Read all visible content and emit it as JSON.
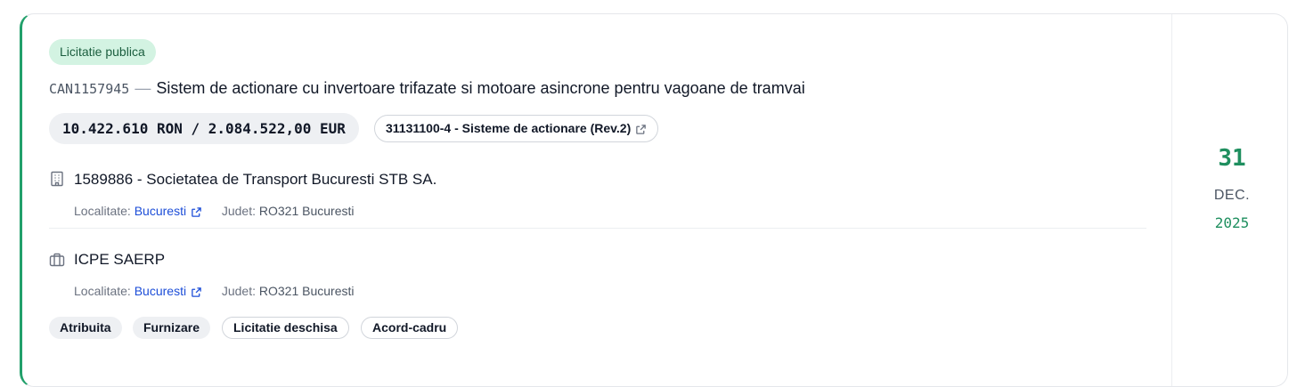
{
  "status_badge": "Licitatie publica",
  "notice": {
    "code": "CAN1157945",
    "separator": "—",
    "title": "Sistem de actionare cu invertoare trifazate si motoare asincrone pentru vagoane de tramvai"
  },
  "price": "10.422.610 RON / 2.084.522,00 EUR",
  "cpv": "31131100-4 - Sisteme de actionare (Rev.2)",
  "authority": {
    "name": "1589886 - Societatea de Transport Bucuresti STB SA.",
    "locality_label": "Localitate:",
    "locality": "Bucuresti",
    "county_label": "Judet:",
    "county": "RO321 Bucuresti"
  },
  "supplier": {
    "name": "ICPE SAERP",
    "locality_label": "Localitate:",
    "locality": "Bucuresti",
    "county_label": "Judet:",
    "county": "RO321 Bucuresti"
  },
  "tags": [
    "Atribuita",
    "Furnizare",
    "Licitatie deschisa",
    "Acord-cadru"
  ],
  "date": {
    "day": "31",
    "month": "DEC.",
    "year": "2025"
  },
  "colors": {
    "accent": "#22a06b",
    "badge_bg": "#d3f3e2",
    "link": "#1d4ed8"
  },
  "icons": [
    "building-icon",
    "briefcase-icon",
    "external-link-icon"
  ]
}
